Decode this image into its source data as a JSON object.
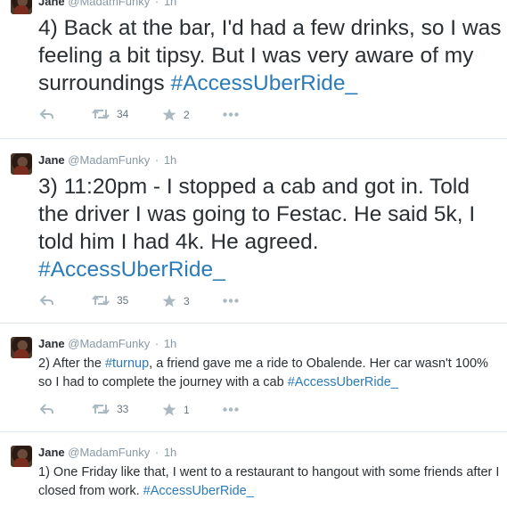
{
  "tweets": [
    {
      "name": "Jane",
      "handle": "@MadamFunky",
      "separator": "·",
      "time": "1h",
      "text_parts": [
        "4) Back at the bar, I'd had a few drinks, so I was feeling a bit tipsy. But I was very aware of my surroundings "
      ],
      "hashtag": "#AccessUberRide_",
      "retweets": "34",
      "favorites": "2"
    },
    {
      "name": "Jane",
      "handle": "@MadamFunky",
      "separator": "·",
      "time": "1h",
      "text_parts": [
        "3) 11:20pm - I stopped a cab and got in. Told the driver I was going to Festac. He said 5k, I told him I had 4k. He agreed. "
      ],
      "hashtag": "#AccessUberRide_",
      "retweets": "35",
      "favorites": "3"
    },
    {
      "name": "Jane",
      "handle": "@MadamFunky",
      "separator": "·",
      "time": "1h",
      "text_parts": [
        "2) After the ",
        ", a friend gave me a ride to Obalende. Her car wasn't 100% so I had to complete the journey with a cab "
      ],
      "inline_hashtag": "#turnup",
      "hashtag": "#AccessUberRide_",
      "retweets": "33",
      "favorites": "1"
    },
    {
      "name": "Jane",
      "handle": "@MadamFunky",
      "separator": "·",
      "time": "1h",
      "text_parts": [
        "1) One Friday like that, I went to a restaurant to hangout with some friends after I closed from work. "
      ],
      "hashtag": "#AccessUberRide_"
    }
  ],
  "icons": {
    "reply": "reply-arrow",
    "retweet": "retweet-arrows",
    "favorite": "star",
    "more": "ellipsis"
  },
  "colors": {
    "link": "#2b7bb9",
    "muted": "#8899a6",
    "text": "#292f33"
  }
}
